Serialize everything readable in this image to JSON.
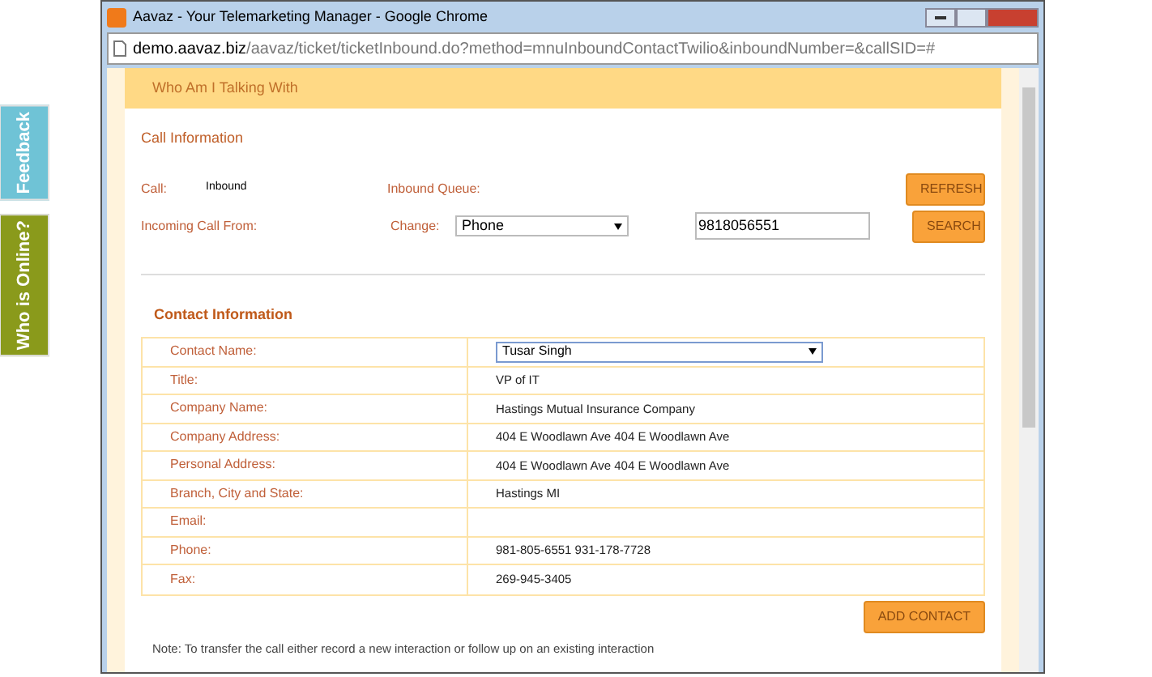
{
  "side_tabs": [
    {
      "label": "Feedback",
      "color": "#6fc3d6"
    },
    {
      "label": "Who is Online?",
      "color": "#8a9a1b"
    }
  ],
  "window": {
    "title": "Aavaz - Your Telemarketing Manager - Google Chrome",
    "url_host": "demo.aavaz.biz",
    "url_path": "/aavaz/ticket/ticketInbound.do?method=mnuInboundContactTwilio&inboundNumber=&callSID=#"
  },
  "header": "Who Am I Talking With",
  "call_information": {
    "title": "Call Information",
    "call_label": "Call:",
    "call_value": "Inbound",
    "queue_label": "Inbound Queue:",
    "refresh_button": "REFRESH",
    "incoming_label": "Incoming Call From:",
    "change_label": "Change:",
    "change_select": "Phone",
    "number_value": "9818056551",
    "search_button": "SEARCH"
  },
  "contact_information": {
    "title": "Contact Information",
    "rows": [
      {
        "label": "Contact Name:",
        "kind": "select",
        "value": "Tusar Singh"
      },
      {
        "label": "Title:",
        "kind": "text",
        "value": "VP of IT"
      },
      {
        "label": "Company Name:",
        "kind": "text",
        "value": "Hastings Mutual Insurance Company"
      },
      {
        "label": "Company Address:",
        "kind": "text",
        "value": "404 E Woodlawn Ave 404 E Woodlawn Ave"
      },
      {
        "label": "Personal Address:",
        "kind": "text",
        "value": "404 E Woodlawn Ave 404 E Woodlawn Ave"
      },
      {
        "label": "Branch, City and State:",
        "kind": "text",
        "value": "Hastings MI"
      },
      {
        "label": "Email:",
        "kind": "text"
      },
      {
        "label": "Phone:",
        "kind": "text",
        "value": "981-805-6551 931-178-7728"
      },
      {
        "label": "Fax:",
        "kind": "text",
        "value": "269-945-3405"
      }
    ],
    "add_button": "ADD CONTACT"
  },
  "note": "Note: To transfer the call either record a new interaction or follow up on an existing interaction"
}
